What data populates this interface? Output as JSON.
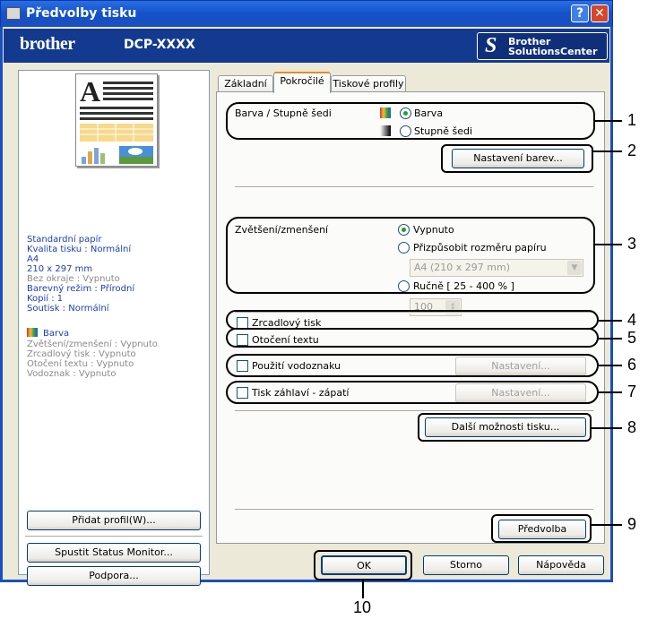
{
  "window": {
    "title": "Předvolby tisku",
    "help_glyph": "?",
    "close_glyph": "✕"
  },
  "brand": {
    "logo": "brother",
    "model": "DCP-XXXX",
    "solutions_line1": "Brother",
    "solutions_line2": "SolutionsCenter",
    "solutions_glyph": "S"
  },
  "summary": {
    "lines": [
      "Standardní papír",
      "Kvalita tisku : Normální",
      "A4",
      "210 x 297 mm"
    ],
    "gray_lines": [
      "Bez okraje : Vypnuto"
    ],
    "lines2": [
      "Barevný režim : Přírodní",
      "Kopií : 1",
      "Soutisk : Normální"
    ],
    "color_label": "Barva",
    "gray_lines2": [
      "Zvětšení/zmenšení : Vypnuto",
      "Zrcadlový tisk : Vypnuto",
      "Otočení textu : Vypnuto",
      "Vodoznak : Vypnuto"
    ]
  },
  "left_buttons": {
    "add_profile": "Přidat profil(W)...",
    "status_monitor": "Spustit Status Monitor...",
    "support": "Podpora..."
  },
  "tabs": [
    "Základní",
    "Pokročilé",
    "Tiskové profily"
  ],
  "advanced": {
    "color_group_label": "Barva / Stupně šedi",
    "color_option": "Barva",
    "gray_option": "Stupně šedi",
    "color_settings_button": "Nastavení barev...",
    "scaling_label": "Zvětšení/zmenšení",
    "scaling_off": "Vypnuto",
    "fit_to_paper": "Přizpůsobit rozměru papíru",
    "paper_size_value": "A4 (210 x 297 mm)",
    "manual": "Ručně [ 25 - 400 % ]",
    "manual_value": "100",
    "mirror": "Zrcadlový tisk",
    "reverse": "Otočení textu",
    "watermark": "Použití vodoznaku",
    "watermark_settings": "Nastavení...",
    "header_footer": "Tisk záhlaví - zápatí",
    "header_footer_settings": "Nastavení...",
    "other_options": "Další možnosti tisku...",
    "default": "Předvolba"
  },
  "dialog_buttons": {
    "ok": "OK",
    "cancel": "Storno",
    "help": "Nápověda"
  },
  "callouts": [
    "1",
    "2",
    "3",
    "4",
    "5",
    "6",
    "7",
    "8",
    "9",
    "10"
  ]
}
